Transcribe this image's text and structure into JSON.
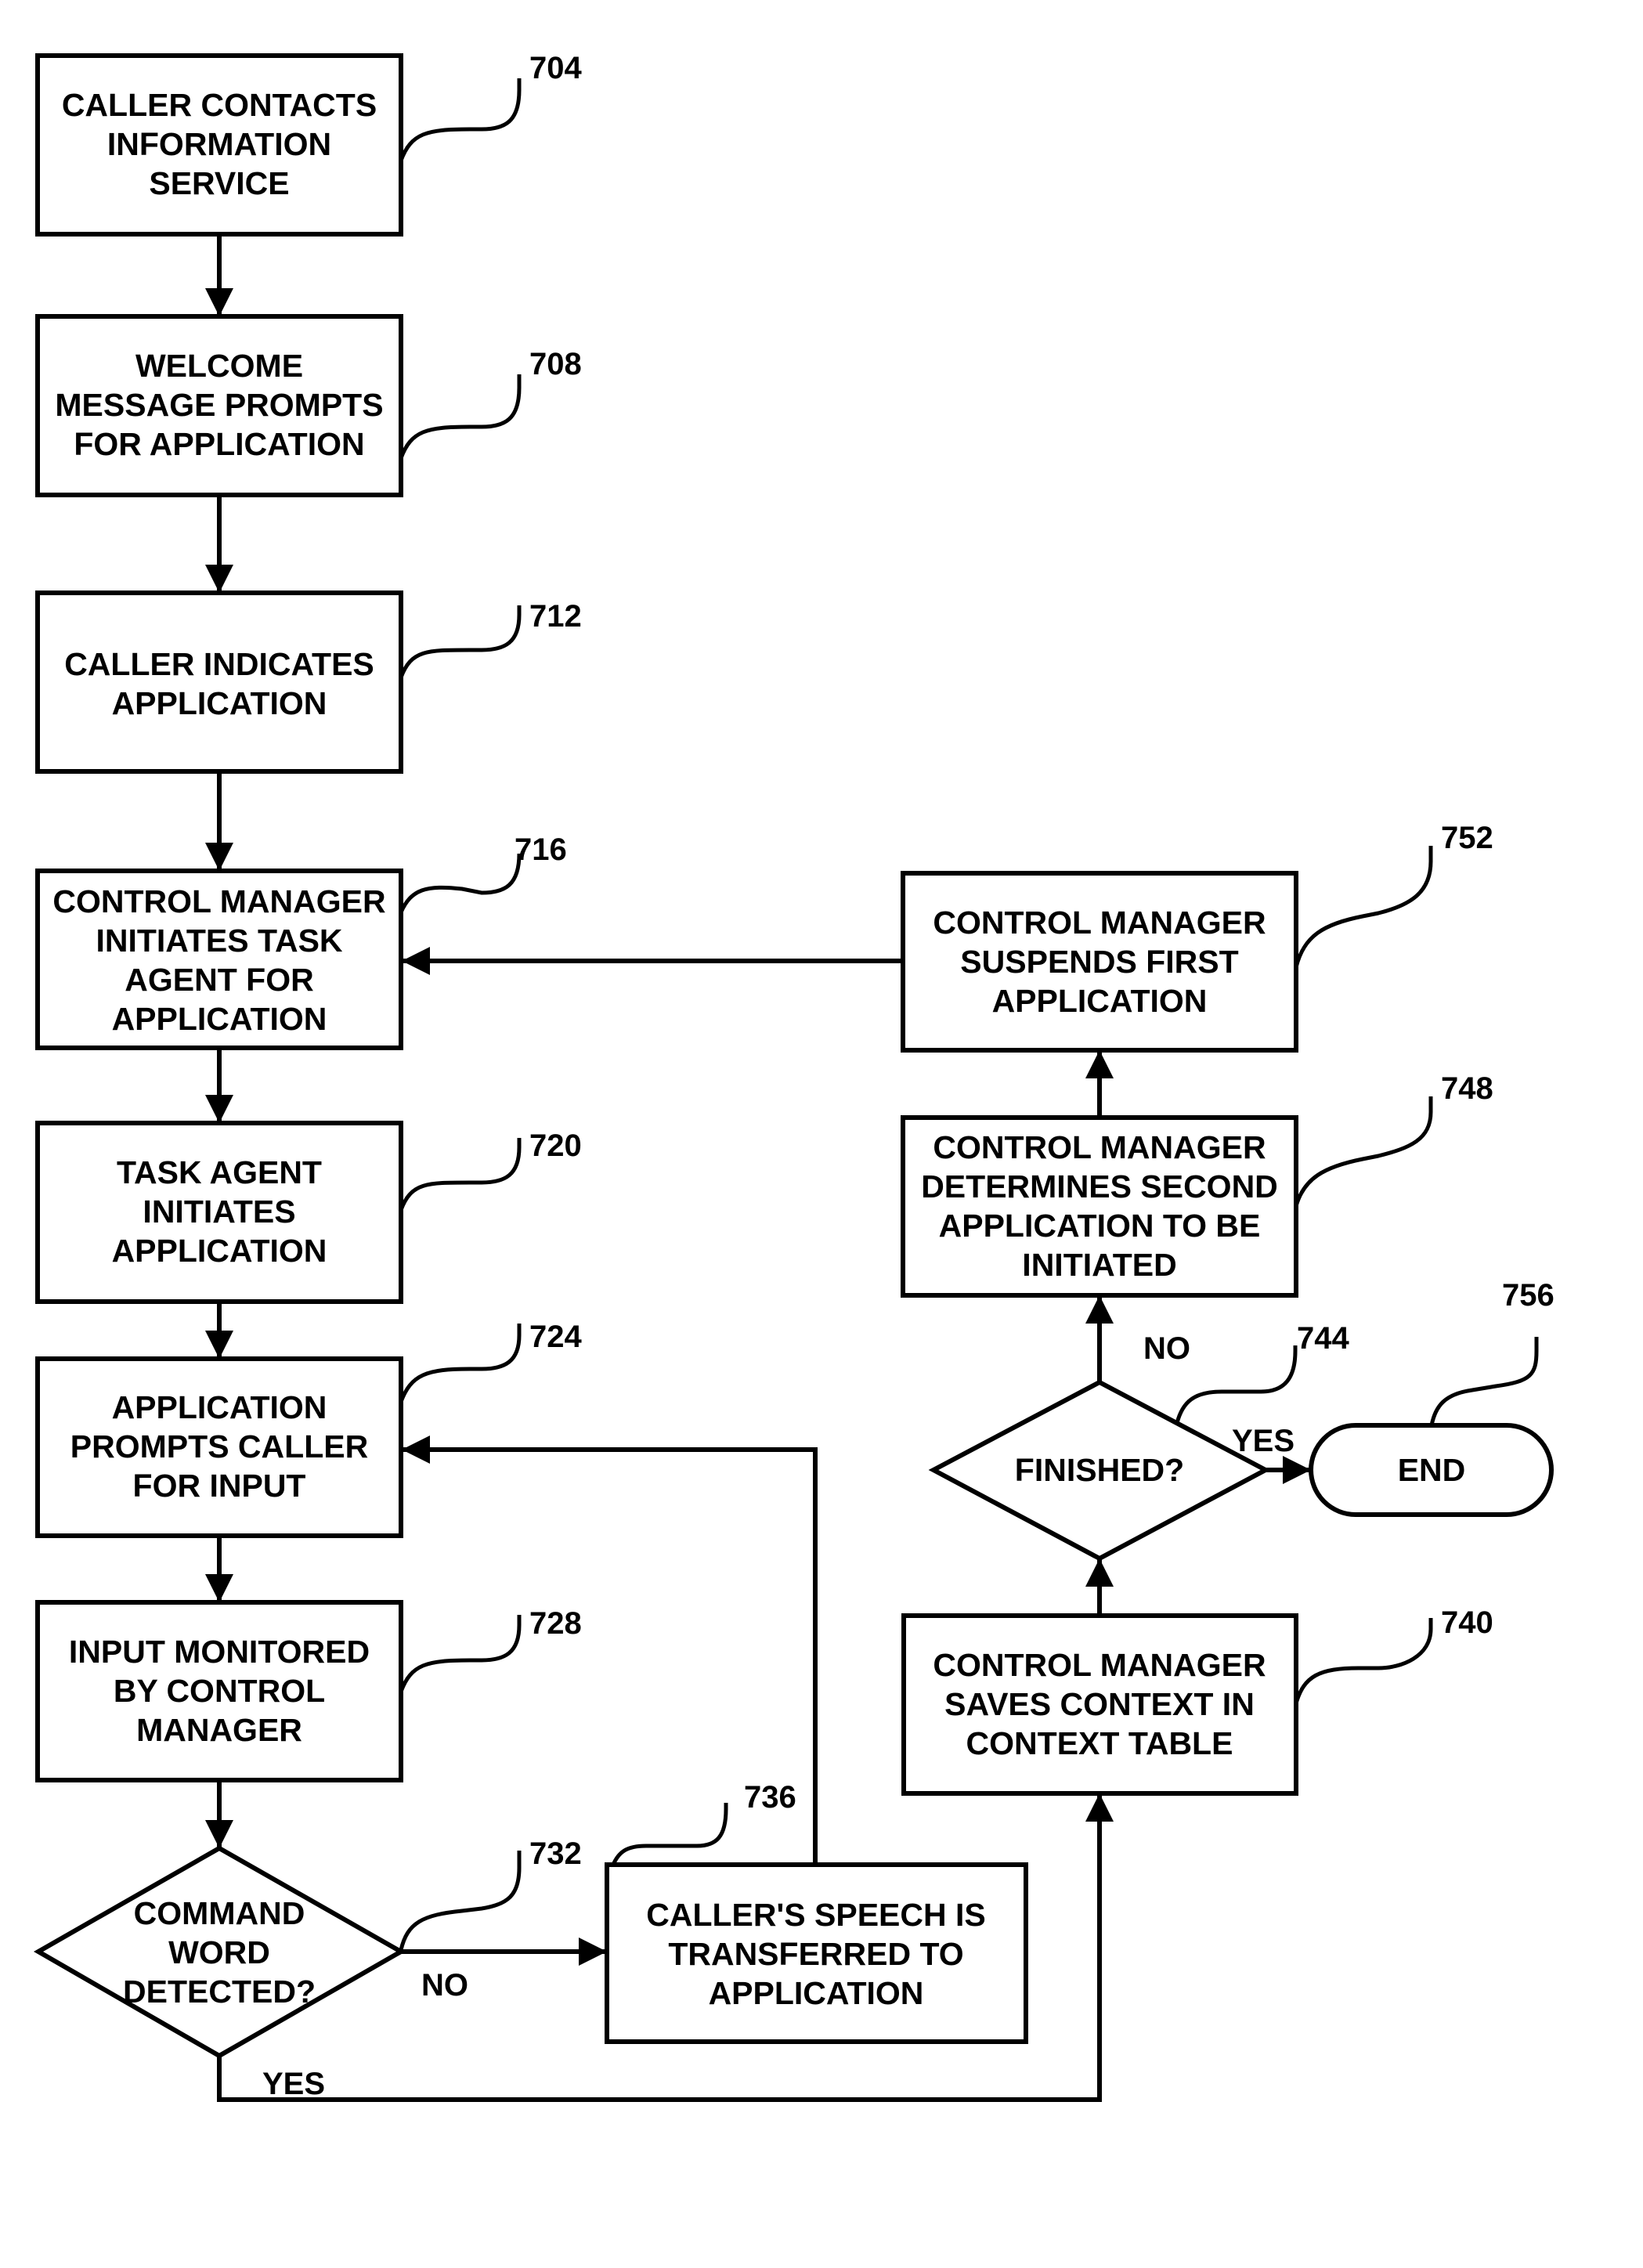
{
  "diagram": {
    "type": "flowchart",
    "nodes": {
      "n704": {
        "ref": "704",
        "shape": "process",
        "lines": [
          "CALLER CONTACTS",
          "INFORMATION",
          "SERVICE"
        ]
      },
      "n708": {
        "ref": "708",
        "shape": "process",
        "lines": [
          "WELCOME",
          "MESSAGE PROMPTS",
          "FOR APPLICATION"
        ]
      },
      "n712": {
        "ref": "712",
        "shape": "process",
        "lines": [
          "CALLER INDICATES",
          "APPLICATION"
        ]
      },
      "n716": {
        "ref": "716",
        "shape": "process",
        "lines": [
          "CONTROL MANAGER",
          "INITIATES TASK",
          "AGENT FOR",
          "APPLICATION"
        ]
      },
      "n720": {
        "ref": "720",
        "shape": "process",
        "lines": [
          "TASK AGENT",
          "INITIATES",
          "APPLICATION"
        ]
      },
      "n724": {
        "ref": "724",
        "shape": "process",
        "lines": [
          "APPLICATION",
          "PROMPTS CALLER",
          "FOR INPUT"
        ]
      },
      "n728": {
        "ref": "728",
        "shape": "process",
        "lines": [
          "INPUT MONITORED",
          "BY CONTROL",
          "MANAGER"
        ]
      },
      "n732": {
        "ref": "732",
        "shape": "decision",
        "lines": [
          "COMMAND",
          "WORD",
          "DETECTED?"
        ]
      },
      "n736": {
        "ref": "736",
        "shape": "process",
        "lines": [
          "CALLER'S SPEECH IS",
          "TRANSFERRED TO",
          "APPLICATION"
        ]
      },
      "n740": {
        "ref": "740",
        "shape": "process",
        "lines": [
          "CONTROL MANAGER",
          "SAVES CONTEXT IN",
          "CONTEXT TABLE"
        ]
      },
      "n744": {
        "ref": "744",
        "shape": "decision",
        "lines": [
          "FINISHED?"
        ]
      },
      "n748": {
        "ref": "748",
        "shape": "process",
        "lines": [
          "CONTROL MANAGER",
          "DETERMINES SECOND",
          "APPLICATION TO BE",
          "INITIATED"
        ]
      },
      "n752": {
        "ref": "752",
        "shape": "process",
        "lines": [
          "CONTROL MANAGER",
          "SUSPENDS FIRST",
          "APPLICATION"
        ]
      },
      "n756": {
        "ref": "756",
        "shape": "terminal",
        "lines": [
          "END"
        ]
      }
    },
    "edges": [
      {
        "from": "704",
        "to": "708"
      },
      {
        "from": "708",
        "to": "712"
      },
      {
        "from": "712",
        "to": "716"
      },
      {
        "from": "716",
        "to": "720"
      },
      {
        "from": "720",
        "to": "724"
      },
      {
        "from": "724",
        "to": "728"
      },
      {
        "from": "728",
        "to": "732"
      },
      {
        "from": "732",
        "to": "736",
        "label": "NO"
      },
      {
        "from": "732",
        "to": "740",
        "label": "YES"
      },
      {
        "from": "736",
        "to": "724"
      },
      {
        "from": "740",
        "to": "744"
      },
      {
        "from": "744",
        "to": "756",
        "label": "YES"
      },
      {
        "from": "744",
        "to": "748",
        "label": "NO"
      },
      {
        "from": "748",
        "to": "752"
      },
      {
        "from": "752",
        "to": "716"
      }
    ],
    "branch_labels": {
      "no_732": "NO",
      "yes_732": "YES",
      "no_744": "NO",
      "yes_744": "YES"
    }
  }
}
